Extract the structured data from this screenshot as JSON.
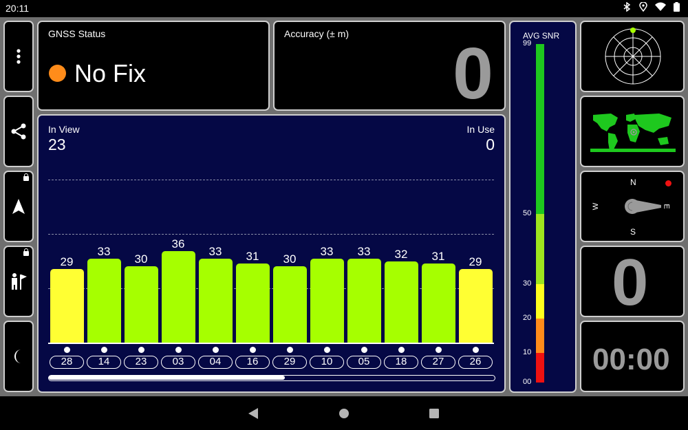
{
  "status_bar": {
    "time": "20:11",
    "icons": [
      "bluetooth-icon",
      "location-icon",
      "wifi-icon",
      "battery-icon"
    ]
  },
  "gnss_status": {
    "title": "GNSS Status",
    "value": "No Fix",
    "indicator_color": "#ff8c1a"
  },
  "accuracy": {
    "title": "Accuracy (± m)",
    "value": "0"
  },
  "in_view": {
    "label": "In View",
    "value": "23"
  },
  "in_use": {
    "label": "In Use",
    "value": "0"
  },
  "avg_snr": {
    "title": "AVG SNR",
    "ticks": [
      "99",
      "50",
      "30",
      "20",
      "10",
      "00"
    ],
    "bands": [
      {
        "from": 50,
        "to": 99,
        "color": "#1ec81e"
      },
      {
        "from": 30,
        "to": 50,
        "color": "#9ee51e"
      },
      {
        "from": 20,
        "to": 30,
        "color": "#ffff1e"
      },
      {
        "from": 10,
        "to": 20,
        "color": "#ff8c1a"
      },
      {
        "from": 0,
        "to": 10,
        "color": "#ee1111"
      }
    ]
  },
  "chart_data": {
    "type": "bar",
    "categories": [
      "28",
      "14",
      "23",
      "03",
      "04",
      "16",
      "29",
      "10",
      "05",
      "18",
      "27",
      "26"
    ],
    "values": [
      29,
      33,
      30,
      36,
      33,
      31,
      30,
      33,
      33,
      32,
      31,
      29
    ],
    "bar_colors": [
      "#ffff33",
      "#a6ff00",
      "#a6ff00",
      "#a6ff00",
      "#a6ff00",
      "#a6ff00",
      "#a6ff00",
      "#a6ff00",
      "#a6ff00",
      "#a6ff00",
      "#a6ff00",
      "#ffff33"
    ],
    "ylim": [
      0,
      50
    ],
    "scroll_position": 0.53
  },
  "compass": {
    "north": "N",
    "south": "S",
    "east": "E",
    "west": "W"
  },
  "speed": {
    "value": "0"
  },
  "timer": {
    "value": "00:00"
  },
  "colors": {
    "background": "#6f6f6f",
    "panel": "#000000",
    "chart_bg": "#050845",
    "accent_red": "#ee1111"
  }
}
